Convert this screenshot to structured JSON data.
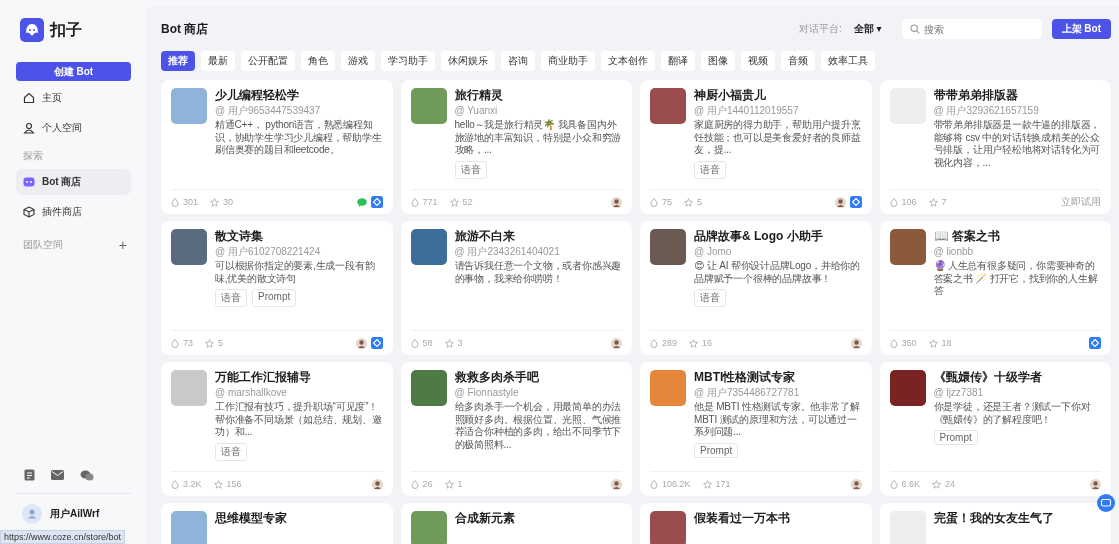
{
  "sidebar": {
    "logo_text": "扣子",
    "create_button": "创建 Bot",
    "nav_top": [
      {
        "label": "主页",
        "selected": false
      },
      {
        "label": "个人空间",
        "selected": false
      }
    ],
    "section_label": "探索",
    "nav_explore": [
      {
        "label": "Bot 商店",
        "selected": true
      },
      {
        "label": "插件商店",
        "selected": false
      }
    ],
    "team_label": "团队空间",
    "team_add": "+",
    "user_name": "用户AiIWrf"
  },
  "header": {
    "title": "Bot 商店",
    "platform_label": "对话平台:",
    "platform_value": "全部 ▾",
    "search": {
      "placeholder": "搜索"
    },
    "publish_button": "上架 Bot"
  },
  "tabs": [
    {
      "label": "推荐",
      "selected": true
    },
    {
      "label": "最新",
      "selected": false
    },
    {
      "label": "公开配置",
      "selected": false
    },
    {
      "label": "角色",
      "selected": false
    },
    {
      "label": "游戏",
      "selected": false
    },
    {
      "label": "学习助手",
      "selected": false
    },
    {
      "label": "休闲娱乐",
      "selected": false
    },
    {
      "label": "咨询",
      "selected": false
    },
    {
      "label": "商业助手",
      "selected": false
    },
    {
      "label": "文本创作",
      "selected": false
    },
    {
      "label": "翻译",
      "selected": false
    },
    {
      "label": "图像",
      "selected": false
    },
    {
      "label": "视频",
      "selected": false
    },
    {
      "label": "音频",
      "selected": false
    },
    {
      "label": "效率工具",
      "selected": false
    }
  ],
  "cards": [
    {
      "title": "少儿编程轻松学",
      "author": "@ 用户9653447539437",
      "description": "精通C++， python语言，熟悉编程知识，协助学生学习少儿编程，帮助学生刷信奥赛的题目和leetcode。",
      "likes": "301",
      "stars": "30",
      "badges": [
        {
          "kind": "wechat"
        },
        {
          "kind": "app"
        }
      ]
    },
    {
      "title": "旅行精灵",
      "author": "@ Yuanxi",
      "description": "hello～我是旅行精灵🌴 我具备国内外旅游地的丰富知识，特别是小众和穷游攻略，...",
      "tags": [
        "语音"
      ],
      "likes": "771",
      "stars": "52",
      "badges": [
        {
          "kind": "avatar"
        }
      ]
    },
    {
      "title": "神厨小福贵儿",
      "author": "@ 用户1440112019557",
      "description": "家庭厨房的得力助手，帮助用户提升烹饪技能；也可以是美食爱好者的良师益友，提...",
      "tags": [
        "语音"
      ],
      "likes": "75",
      "stars": "5",
      "badges": [
        {
          "kind": "avatar"
        },
        {
          "kind": "app"
        }
      ]
    },
    {
      "title": "带带弟弟排版器",
      "author": "@ 用户3293621657159",
      "description": "带带弟弟排版器是一款牛逼的排版器，能够将 csv 中的对话转换成精美的公众号排版，让用户轻松地将对话转化为可视化内容，...",
      "likes": "106",
      "stars": "7",
      "action": "立即试用"
    },
    {
      "title": "散文诗集",
      "author": "@ 用户6102708221424",
      "description": "可以根据你指定的要素,生成一段有韵味,优美的散文诗句",
      "tags": [
        "语音",
        "Prompt"
      ],
      "likes": "73",
      "stars": "5",
      "badges": [
        {
          "kind": "avatar"
        },
        {
          "kind": "app"
        }
      ]
    },
    {
      "title": "旅游不白来",
      "author": "@ 用户2343261404021",
      "description": "请告诉我任意一个文物，或者你感兴趣的事物，我来给你唠唠！",
      "likes": "58",
      "stars": "3",
      "badges": [
        {
          "kind": "avatar"
        }
      ]
    },
    {
      "title": "品牌故事& Logo 小助手",
      "author": "@ Jomo",
      "description": "😍 让 AI 帮你设计品牌Logo，并给你的品牌赋予一个很棒的品牌故事！",
      "tags": [
        "语音"
      ],
      "likes": "289",
      "stars": "16",
      "badges": [
        {
          "kind": "avatar"
        }
      ]
    },
    {
      "title": "📖 答案之书",
      "author": "@ lionbb",
      "description": "🔮 人生总有很多疑问，你需要神奇的答案之书 🪄 打开它，找到你的人生解答",
      "likes": "350",
      "stars": "18",
      "badges": [
        {
          "kind": "app"
        }
      ]
    },
    {
      "title": "万能工作汇报辅导",
      "author": "@ marshallkove",
      "description": "工作汇报有技巧，提升职场“可见度”！帮你准备不同场景（如总结、规划、邀功）和...",
      "tags": [
        "语音"
      ],
      "likes": "3.2K",
      "stars": "156",
      "badges": [
        {
          "kind": "avatar"
        }
      ]
    },
    {
      "title": "救救多肉杀手吧",
      "author": "@ Fionnastyle",
      "description": "给多肉杀手一个机会，用最简单的办法照顾好多肉。根据位置、光照、气候推荐适合你种植的多肉，给出不同季节下的极简照料...",
      "likes": "26",
      "stars": "1",
      "badges": [
        {
          "kind": "avatar"
        }
      ]
    },
    {
      "title": "MBTI性格测试专家",
      "author": "@ 用户7354486727781",
      "description": "他是 MBTI 性格测试专家。他非常了解 MBTI 测试的原理和方法，可以通过一系列问题...",
      "tags": [
        "Prompt"
      ],
      "likes": "106.2K",
      "stars": "171",
      "badges": [
        {
          "kind": "avatar"
        }
      ]
    },
    {
      "title": "《甄嬛传》十级学者",
      "author": "@ ljzz7381",
      "description": "你是学徒，还是王者？测试一下你对《甄嬛传》的了解程度吧！",
      "tags": [
        "Prompt"
      ],
      "likes": "6.6K",
      "stars": "24",
      "badges": [
        {
          "kind": "avatar"
        }
      ]
    },
    {
      "title": "思维模型专家"
    },
    {
      "title": "合成新元素"
    },
    {
      "title": "假装看过一万本书"
    },
    {
      "title": "完蛋！我的女友生气了"
    }
  ],
  "status_url": "https://www.coze.cn/store/bot"
}
